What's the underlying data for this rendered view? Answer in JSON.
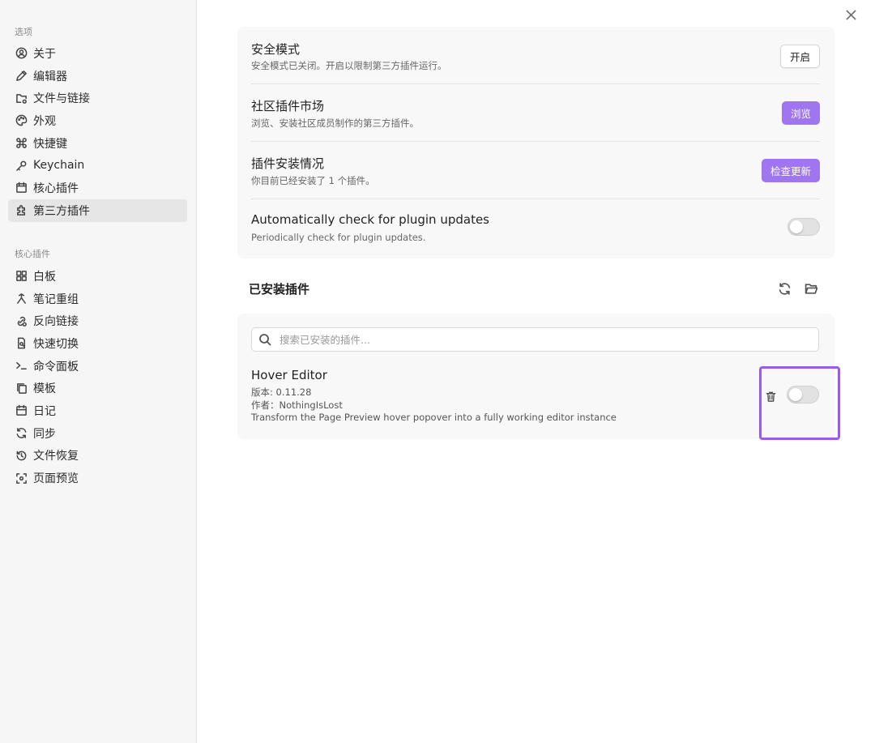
{
  "sidebar": {
    "section_options": "选项",
    "options_items": [
      {
        "label": "关于",
        "icon": "user-circle-icon"
      },
      {
        "label": "编辑器",
        "icon": "pencil-icon"
      },
      {
        "label": "文件与链接",
        "icon": "folder-cog-icon"
      },
      {
        "label": "外观",
        "icon": "palette-icon"
      },
      {
        "label": "快捷键",
        "icon": "command-icon"
      },
      {
        "label": "Keychain",
        "icon": "key-icon"
      },
      {
        "label": "核心插件",
        "icon": "calendar-box-icon"
      },
      {
        "label": "第三方插件",
        "icon": "puzzle-icon",
        "active": true
      }
    ],
    "section_core": "核心插件",
    "core_items": [
      {
        "label": "白板",
        "icon": "grid-icon"
      },
      {
        "label": "笔记重组",
        "icon": "merge-icon"
      },
      {
        "label": "反向链接",
        "icon": "link-search-icon"
      },
      {
        "label": "快速切换",
        "icon": "file-search-icon"
      },
      {
        "label": "命令面板",
        "icon": "terminal-icon"
      },
      {
        "label": "模板",
        "icon": "files-icon"
      },
      {
        "label": "日记",
        "icon": "calendar-icon"
      },
      {
        "label": "同步",
        "icon": "sync-icon"
      },
      {
        "label": "文件恢复",
        "icon": "history-icon"
      },
      {
        "label": "页面预览",
        "icon": "scan-eye-icon"
      }
    ]
  },
  "settings": {
    "safe_mode": {
      "name": "安全模式",
      "desc": "安全模式已关闭。开启以限制第三方插件运行。",
      "button": "开启"
    },
    "community": {
      "name": "社区插件市场",
      "desc": "浏览、安装社区成员制作的第三方插件。",
      "button": "浏览"
    },
    "install_status": {
      "name": "插件安装情况",
      "desc": "你目前已经安装了 1 个插件。",
      "button": "检查更新"
    },
    "auto_check": {
      "name": "Automatically check for plugin updates",
      "desc": "Periodically check for plugin updates.",
      "enabled": false
    }
  },
  "installed": {
    "title": "已安装插件",
    "search_placeholder": "搜索已安装的插件...",
    "plugins": [
      {
        "name": "Hover Editor",
        "version": "版本: 0.11.28",
        "author": "作者：NothingIsLost",
        "description": "Transform the Page Preview hover popover into a fully working editor instance",
        "enabled": false
      }
    ]
  },
  "colors": {
    "accent": "#9f75f0",
    "highlight": "#9b59f0"
  }
}
